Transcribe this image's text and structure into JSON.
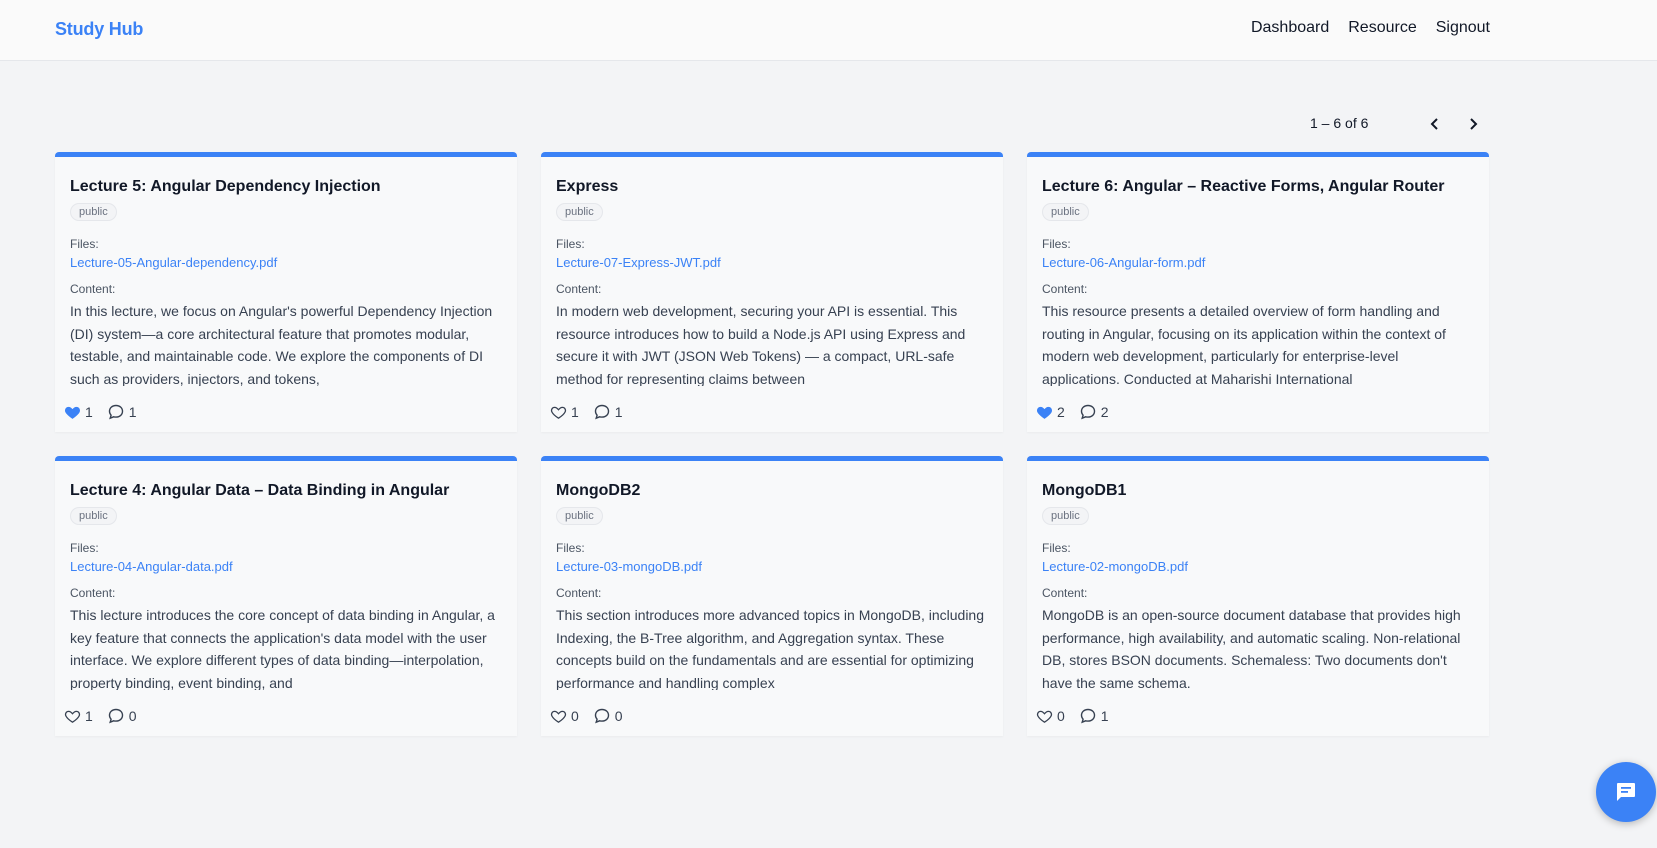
{
  "app": {
    "brand": "Study Hub"
  },
  "nav": {
    "items": [
      {
        "label": "Dashboard"
      },
      {
        "label": "Resource"
      },
      {
        "label": "Signout"
      }
    ]
  },
  "pagination": {
    "range": "1 – 6 of 6",
    "prev_icon": "chevron-left-icon",
    "next_icon": "chevron-right-icon"
  },
  "labels": {
    "files": "Files:",
    "content": "Content:"
  },
  "colors": {
    "accent": "#3b82f6",
    "liked": "#3b82f6"
  },
  "cards": [
    {
      "title": "Lecture 5: Angular Dependency Injection",
      "visibility": "public",
      "file": "Lecture-05-Angular-dependency.pdf",
      "content": "In this lecture, we focus on Angular's powerful Dependency Injection (DI) system—a core architectural feature that promotes modular, testable, and maintainable code. We explore the components of DI such as providers, injectors, and tokens,",
      "likes": "1",
      "comments": "1",
      "liked": true
    },
    {
      "title": "Express",
      "visibility": "public",
      "file": "Lecture-07-Express-JWT.pdf",
      "content": "In modern web development, securing your API is essential. This resource introduces how to build a Node.js API using Express and secure it with JWT (JSON Web Tokens) — a compact, URL-safe method for representing claims between",
      "likes": "1",
      "comments": "1",
      "liked": false
    },
    {
      "title": "Lecture 6: Angular – Reactive Forms, Angular Router",
      "visibility": "public",
      "file": "Lecture-06-Angular-form.pdf",
      "content": "This resource presents a detailed overview of form handling and routing in Angular, focusing on its application within the context of modern web development, particularly for enterprise-level applications. Conducted at Maharishi International",
      "likes": "2",
      "comments": "2",
      "liked": true
    },
    {
      "title": "Lecture 4: Angular Data – Data Binding in Angular",
      "visibility": "public",
      "file": "Lecture-04-Angular-data.pdf",
      "content": "This lecture introduces the core concept of data binding in Angular, a key feature that connects the application's data model with the user interface. We explore different types of data binding—interpolation, property binding, event binding, and",
      "likes": "1",
      "comments": "0",
      "liked": false
    },
    {
      "title": "MongoDB2",
      "visibility": "public",
      "file": "Lecture-03-mongoDB.pdf",
      "content": "This section introduces more advanced topics in MongoDB, including Indexing, the B-Tree algorithm, and Aggregation syntax. These concepts build on the fundamentals and are essential for optimizing performance and handling complex",
      "likes": "0",
      "comments": "0",
      "liked": false
    },
    {
      "title": "MongoDB1",
      "visibility": "public",
      "file": "Lecture-02-mongoDB.pdf",
      "content": "MongoDB is an open-source document database that provides high performance, high availability, and automatic scaling.  Non-relational DB, stores BSON documents.  Schemaless: Two documents don't have the same schema.",
      "likes": "0",
      "comments": "1",
      "liked": false
    }
  ],
  "fab": {
    "icon": "chat-icon"
  }
}
